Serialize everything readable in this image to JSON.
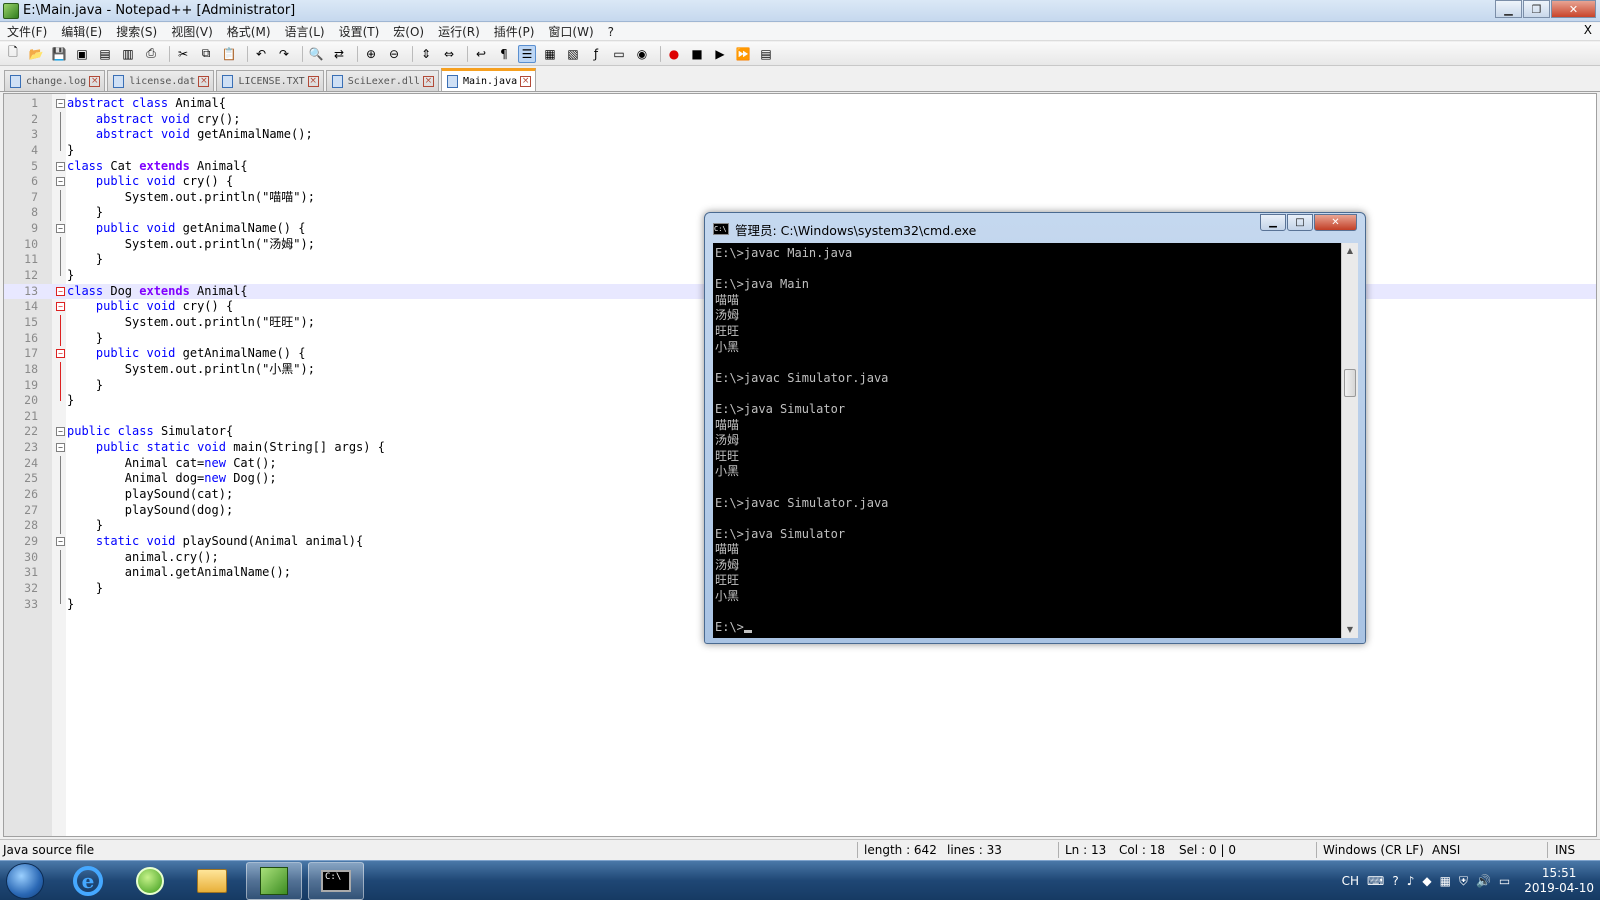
{
  "window": {
    "title": "E:\\Main.java - Notepad++ [Administrator]",
    "min_icon": "minimize-icon",
    "max_icon": "restore-icon",
    "close_icon": "close-icon"
  },
  "menu": {
    "items": [
      "文件(F)",
      "编辑(E)",
      "搜索(S)",
      "视图(V)",
      "格式(M)",
      "语言(L)",
      "设置(T)",
      "宏(O)",
      "运行(R)",
      "插件(P)",
      "窗口(W)",
      "?"
    ],
    "close": "X"
  },
  "tabs": [
    {
      "label": "change.log"
    },
    {
      "label": "license.dat"
    },
    {
      "label": "LICENSE.TXT"
    },
    {
      "label": "SciLexer.dll"
    },
    {
      "label": "Main.java",
      "active": true
    }
  ],
  "code_lines": [
    "abstract class Animal{",
    "    abstract void cry();",
    "    abstract void getAnimalName();",
    "}",
    "class Cat extends Animal{",
    "    public void cry() {",
    "        System.out.println(\"喵喵\");",
    "    }",
    "    public void getAnimalName() {",
    "        System.out.println(\"汤姆\");",
    "    }",
    "}",
    "class Dog extends Animal{",
    "    public void cry() {",
    "        System.out.println(\"旺旺\");",
    "    }",
    "    public void getAnimalName() {",
    "        System.out.println(\"小黑\");",
    "    }",
    "}",
    "",
    "public class Simulator{",
    "    public static void main(String[] args) {",
    "        Animal cat=new Cat();",
    "        Animal dog=new Dog();",
    "        playSound(cat);",
    "        playSound(dog);",
    "    }",
    "    static void playSound(Animal animal){",
    "        animal.cry();",
    "        animal.getAnimalName();",
    "    }",
    "}"
  ],
  "current_line": 13,
  "cmd": {
    "title": "管理员: C:\\Windows\\system32\\cmd.exe",
    "lines": [
      "E:\\>javac Main.java",
      "",
      "E:\\>java Main",
      "喵喵",
      "汤姆",
      "旺旺",
      "小黑",
      "",
      "E:\\>javac Simulator.java",
      "",
      "E:\\>java Simulator",
      "喵喵",
      "汤姆",
      "旺旺",
      "小黑",
      "",
      "E:\\>javac Simulator.java",
      "",
      "E:\\>java Simulator",
      "喵喵",
      "汤姆",
      "旺旺",
      "小黑",
      ""
    ],
    "prompt": "E:\\>"
  },
  "status": {
    "filetype": "Java source file",
    "length": "length : 642",
    "lines": "lines : 33",
    "ln": "Ln : 13",
    "col": "Col : 18",
    "sel": "Sel : 0 | 0",
    "eol": "Windows (CR LF)",
    "encoding": "ANSI",
    "mode": "INS"
  },
  "taskbar": {
    "lang": "CH",
    "time": "15:51",
    "date": "2019-04-10"
  }
}
